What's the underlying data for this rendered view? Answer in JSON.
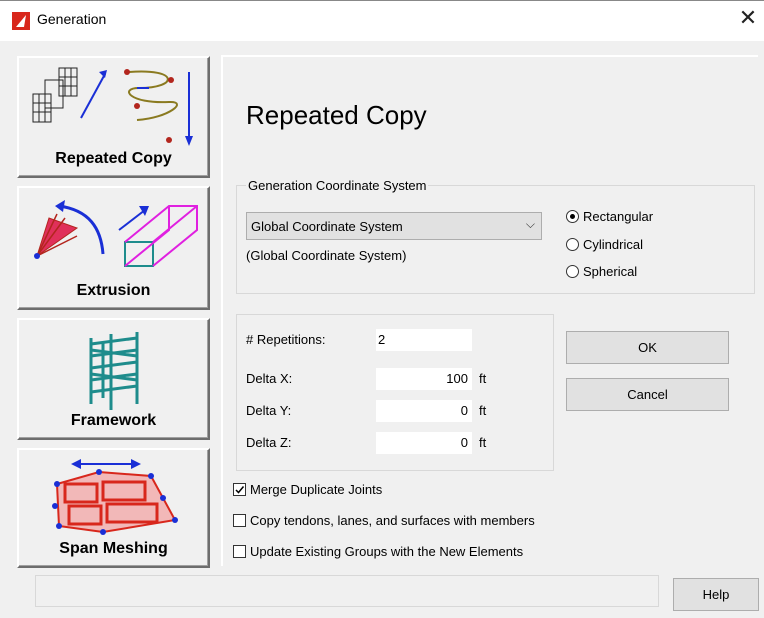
{
  "window": {
    "title": "Generation",
    "close_glyph": "✕",
    "app_icon": "app-logo-icon"
  },
  "tools": [
    {
      "label": "Repeated Copy",
      "icon": "repeated-copy-icon"
    },
    {
      "label": "Extrusion",
      "icon": "extrusion-icon"
    },
    {
      "label": "Framework",
      "icon": "framework-icon"
    },
    {
      "label": "Span Meshing",
      "icon": "span-meshing-icon"
    }
  ],
  "main": {
    "heading": "Repeated Copy",
    "coord_group": {
      "title": "Generation Coordinate System",
      "selected": "Global Coordinate System",
      "subtext": "(Global Coordinate System)",
      "radios": [
        {
          "label": "Rectangular",
          "checked": true
        },
        {
          "label": "Cylindrical",
          "checked": false
        },
        {
          "label": "Spherical",
          "checked": false
        }
      ]
    },
    "fields": [
      {
        "label": "# Repetitions:",
        "value": "2",
        "unit": ""
      },
      {
        "label": "Delta X:",
        "value": "100",
        "unit": "ft"
      },
      {
        "label": "Delta Y:",
        "value": "0",
        "unit": "ft"
      },
      {
        "label": "Delta Z:",
        "value": "0",
        "unit": "ft"
      }
    ],
    "ok_label": "OK",
    "cancel_label": "Cancel",
    "checkboxes": [
      {
        "label": "Merge Duplicate Joints",
        "checked": true
      },
      {
        "label": "Copy tendons, lanes, and surfaces with members",
        "checked": false
      },
      {
        "label": "Update Existing Groups with the New Elements",
        "checked": false
      }
    ]
  },
  "footer": {
    "status_text": "",
    "help_label": "Help"
  },
  "colors": {
    "accent_red": "#d8271c",
    "teal": "#1e8c8c",
    "magenta": "#e020e0",
    "blue": "#1a2fd6"
  }
}
